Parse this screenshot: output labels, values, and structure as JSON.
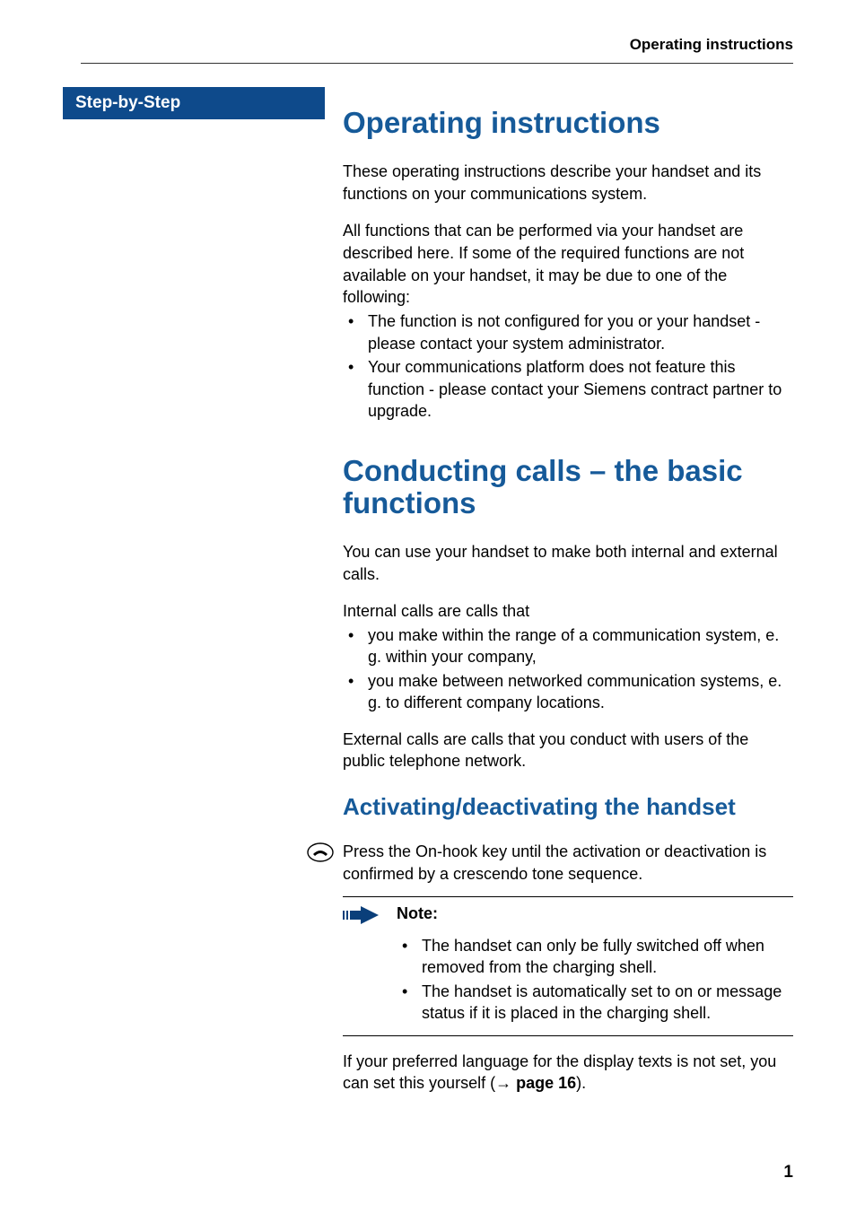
{
  "running_header": "Operating instructions",
  "sidebar": {
    "label": "Step-by-Step"
  },
  "sections": {
    "op_instructions": {
      "title": "Operating instructions",
      "p1": "These operating instructions describe your handset and its functions on your communications system.",
      "p2": "All functions that can be performed via your handset are described here. If some of the required functions are not available on your handset, it may be due to one of the following:",
      "bullets": [
        "The function is not configured for you or your handset - please contact your system administrator.",
        "Your communications platform does not feature this function - please contact your Siemens contract partner to upgrade."
      ]
    },
    "conducting": {
      "title": "Conducting calls – the basic functions",
      "p1": "You can use your handset to make both internal and external calls.",
      "p2": "Internal calls are calls that",
      "bullets": [
        "you make within the range of a communication system, e. g. within your company,",
        "you make between networked communication systems, e. g. to different company locations."
      ],
      "p3": "External calls are calls that you conduct with users of the public telephone network."
    },
    "activating": {
      "title": "Activating/deactivating the handset",
      "step_icon": "onhook-key-icon",
      "step_text": "Press the On-hook key until the activation or deactivation is confirmed by a crescendo tone sequence.",
      "note_label": "Note:",
      "note_bullets": [
        "The handset can only be fully switched off when removed from the charging shell.",
        "The handset is automatically set to on or message status if it is placed in the charging shell."
      ],
      "after_note_prefix": "If your preferred language for the display texts is not set, you can set this yourself (",
      "after_note_xref": "→ page 16",
      "after_note_suffix": ")."
    }
  },
  "page_number": "1"
}
